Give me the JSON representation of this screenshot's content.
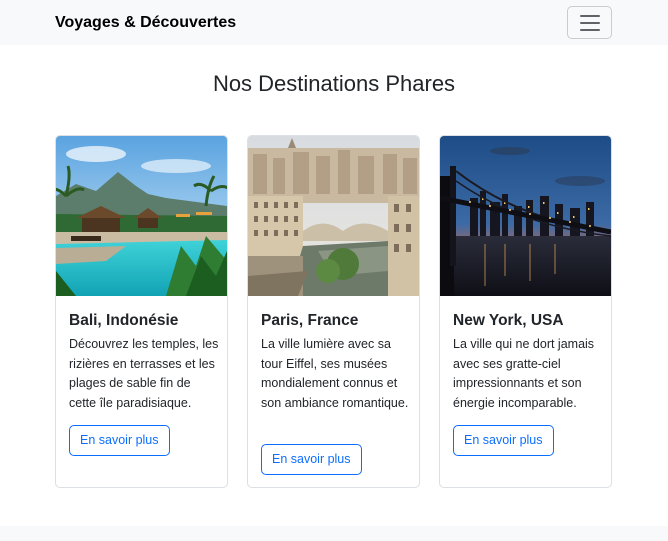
{
  "navbar": {
    "brand": "Voyages & Découvertes",
    "toggler_icon": "hamburger-menu-icon"
  },
  "main": {
    "heading": "Nos Destinations Phares",
    "cards": [
      {
        "title": "Bali, Indonésie",
        "text": "Découvrez les temples, les rizières en terrasses et les plages de sable fin de cette île paradisiaque.",
        "button": "En savoir plus",
        "image": "tropical-pool-resort-photo"
      },
      {
        "title": "Paris, France",
        "text": "La ville lumière avec sa tour Eiffel, ses musées mondialement connus et son ambiance romantique.",
        "button": "En savoir plus",
        "image": "paris-cityscape-photo"
      },
      {
        "title": "New York, USA",
        "text": "La ville qui ne dort jamais avec ses gratte-ciel impressionnants et son énergie incomparable.",
        "button": "En savoir plus",
        "image": "new-york-bridge-night-photo"
      }
    ]
  },
  "colors": {
    "primary": "#0d6efd",
    "navbar_bg": "#f8f9fa",
    "text": "#212529",
    "card_border": "#dcdfe3"
  }
}
